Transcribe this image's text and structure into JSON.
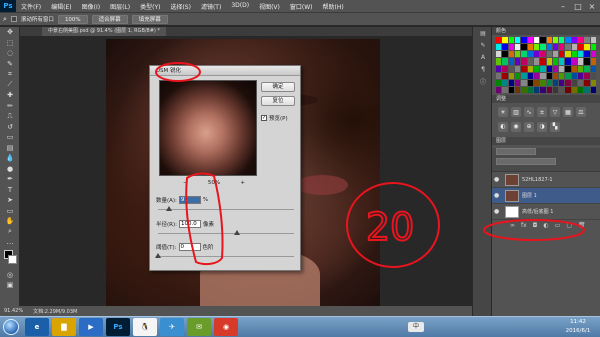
{
  "app": {
    "logo": "Ps"
  },
  "menubar": {
    "items": [
      "文件(F)",
      "编辑(E)",
      "图像(I)",
      "图层(L)",
      "类型(Y)",
      "选择(S)",
      "滤镜(T)",
      "3D(D)",
      "视图(V)",
      "窗口(W)",
      "帮助(H)"
    ]
  },
  "options": {
    "checkbox_label": "滚动所有窗口",
    "zoom_label": "100%",
    "fit_label": "适合屏幕",
    "fill_label": "填充屏幕"
  },
  "document": {
    "tab_label": "中景右侧美图.psd @ 91.4% (图层 1, RGB/8#) *"
  },
  "status": {
    "zoom": "91.42%",
    "doc": "文档:2.29M/9.03M"
  },
  "dialog": {
    "title": "USM 锐化",
    "ok": "确定",
    "reset": "复位",
    "preview_label": "预览(P)",
    "preview_checked": "✓",
    "zoom": "50%",
    "zoom_out": "−",
    "zoom_in": "+",
    "amount_label": "数量(A):",
    "amount_value": "91",
    "amount_unit": "%",
    "radius_label": "半径(R):",
    "radius_value": "100.0",
    "radius_unit": "像素",
    "threshold_label": "阈值(T):",
    "threshold_value": "0",
    "threshold_unit": "色阶",
    "amount_level": 0.08,
    "radius_level": 0.58,
    "threshold_level": 0.0
  },
  "annotation": {
    "number": "20",
    "color": "#e8141e"
  },
  "panels": {
    "swatch_tab": "颜色",
    "adjust_tab": "调整",
    "layers_tab": "图层",
    "layers": [
      {
        "name": "52HL1827-1",
        "eye": "●",
        "thumb": "photo",
        "active": false
      },
      {
        "name": "图层 1",
        "eye": "●",
        "thumb": "photo",
        "active": true
      },
      {
        "name": "高低/后底图 1",
        "eye": "●",
        "thumb": "white",
        "active": false
      }
    ]
  },
  "taskbar": {
    "ime": "中",
    "time": "11:42",
    "date": "2016/6/1"
  },
  "colors": {
    "foreground": "#000000",
    "background": "#ffffff",
    "swatch_set": [
      "#ff0000",
      "#ffff00",
      "#00ff00",
      "#00ffff",
      "#0000ff",
      "#ff00ff",
      "#ffffff",
      "#000000",
      "#ff8000",
      "#80ff00",
      "#00ff80",
      "#0080ff",
      "#8000ff",
      "#ff0080",
      "#808080",
      "#c0c0c0"
    ]
  }
}
